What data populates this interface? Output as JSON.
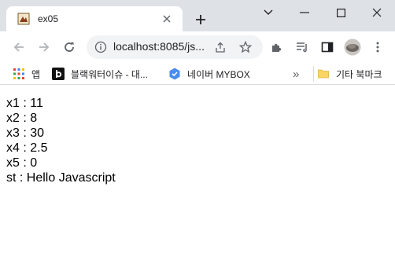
{
  "tab": {
    "title": "ex05"
  },
  "address": {
    "url": "localhost:8085/js..."
  },
  "bookmarks": [
    {
      "label": "앱"
    },
    {
      "label": "블랙워터이슈 - 대..."
    },
    {
      "label": "네이버 MYBOX"
    }
  ],
  "bookmarks_more": "»",
  "bookmarks_other": "기타 북마크",
  "output": [
    {
      "text": "x1 : 11"
    },
    {
      "text": "x2 : 8"
    },
    {
      "text": "x3 : 30"
    },
    {
      "text": "x4 : 2.5"
    },
    {
      "text": "x5 : 0"
    },
    {
      "text": "st : Hello Javascript"
    }
  ]
}
